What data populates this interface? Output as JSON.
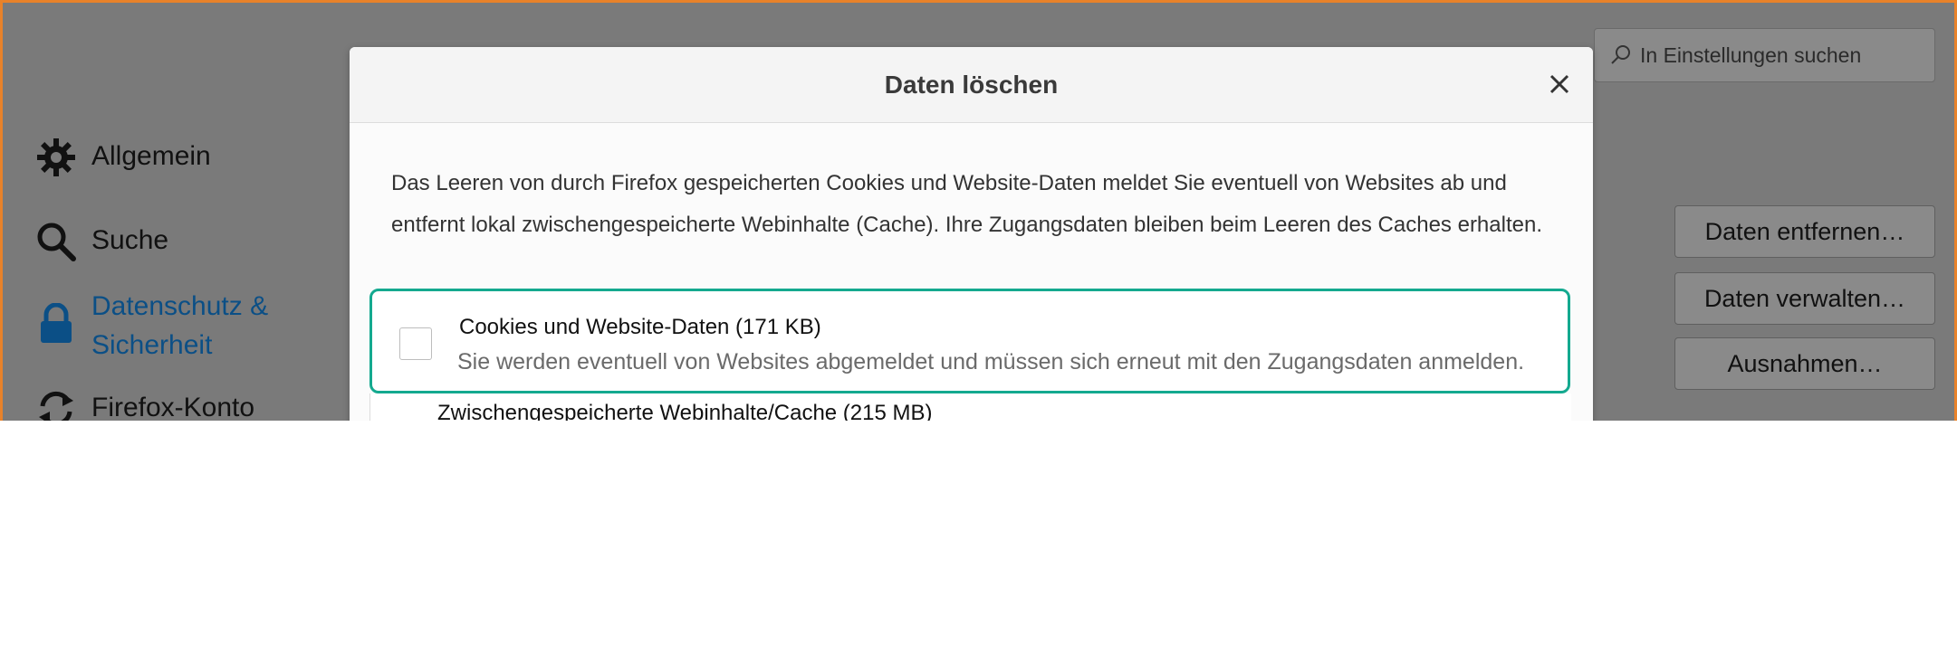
{
  "search": {
    "placeholder": "In Einstellungen suchen"
  },
  "sidebar": {
    "items": [
      {
        "label": "Allgemein"
      },
      {
        "label": "Suche"
      },
      {
        "label": "Datenschutz & Sicherheit",
        "line1": "Datenschutz &",
        "line2": "Sicherheit"
      },
      {
        "label": "Firefox-Konto"
      }
    ]
  },
  "buttons": {
    "remove_data": "Daten entfernen…",
    "manage_data": "Daten verwalten…",
    "exceptions": "Ausnahmen…"
  },
  "dialog": {
    "title": "Daten löschen",
    "description": "Das Leeren von durch Firefox gespeicherten Cookies und Website-Daten meldet Sie eventuell von Websites ab und entfernt lokal zwischengespeicherte Webinhalte (Cache). Ihre Zugangsdaten bleiben beim Leeren des Caches erhalten.",
    "options": [
      {
        "label": "Cookies und Website-Daten (171 KB)",
        "note": "Sie werden eventuell von Websites abgemeldet und müssen sich erneut mit den Zugangsdaten anmelden.",
        "checked": false
      },
      {
        "label": "Zwischengespeicherte Webinhalte/Cache (215 MB)"
      }
    ]
  },
  "colors": {
    "highlight": "#14a98f",
    "frame": "#e8822a",
    "active_link": "#0b4f86"
  }
}
